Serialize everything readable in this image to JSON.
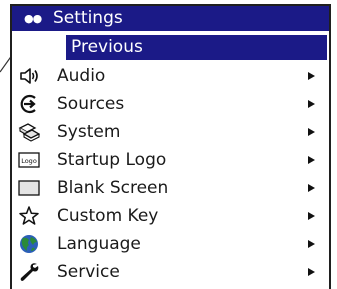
{
  "menu": {
    "title": "Settings",
    "header_dots": "●●",
    "previous_label": "Previous",
    "items": [
      {
        "label": "Audio",
        "icon": "speaker-icon"
      },
      {
        "label": "Sources",
        "icon": "source-arrow-icon"
      },
      {
        "label": "System",
        "icon": "system-chips-icon"
      },
      {
        "label": "Startup Logo",
        "icon": "logo-icon",
        "icon_text": "Logo"
      },
      {
        "label": "Blank Screen",
        "icon": "blank-screen-icon"
      },
      {
        "label": "Custom Key",
        "icon": "star-icon"
      },
      {
        "label": "Language",
        "icon": "globe-icon"
      },
      {
        "label": "Service",
        "icon": "wrench-icon"
      }
    ]
  },
  "colors": {
    "header_bg": "#1b1a87",
    "selected_bg": "#1b1a87",
    "text": "#1a1a1a",
    "globe_green": "#2a8a3a",
    "globe_blue": "#2b5fb8"
  }
}
